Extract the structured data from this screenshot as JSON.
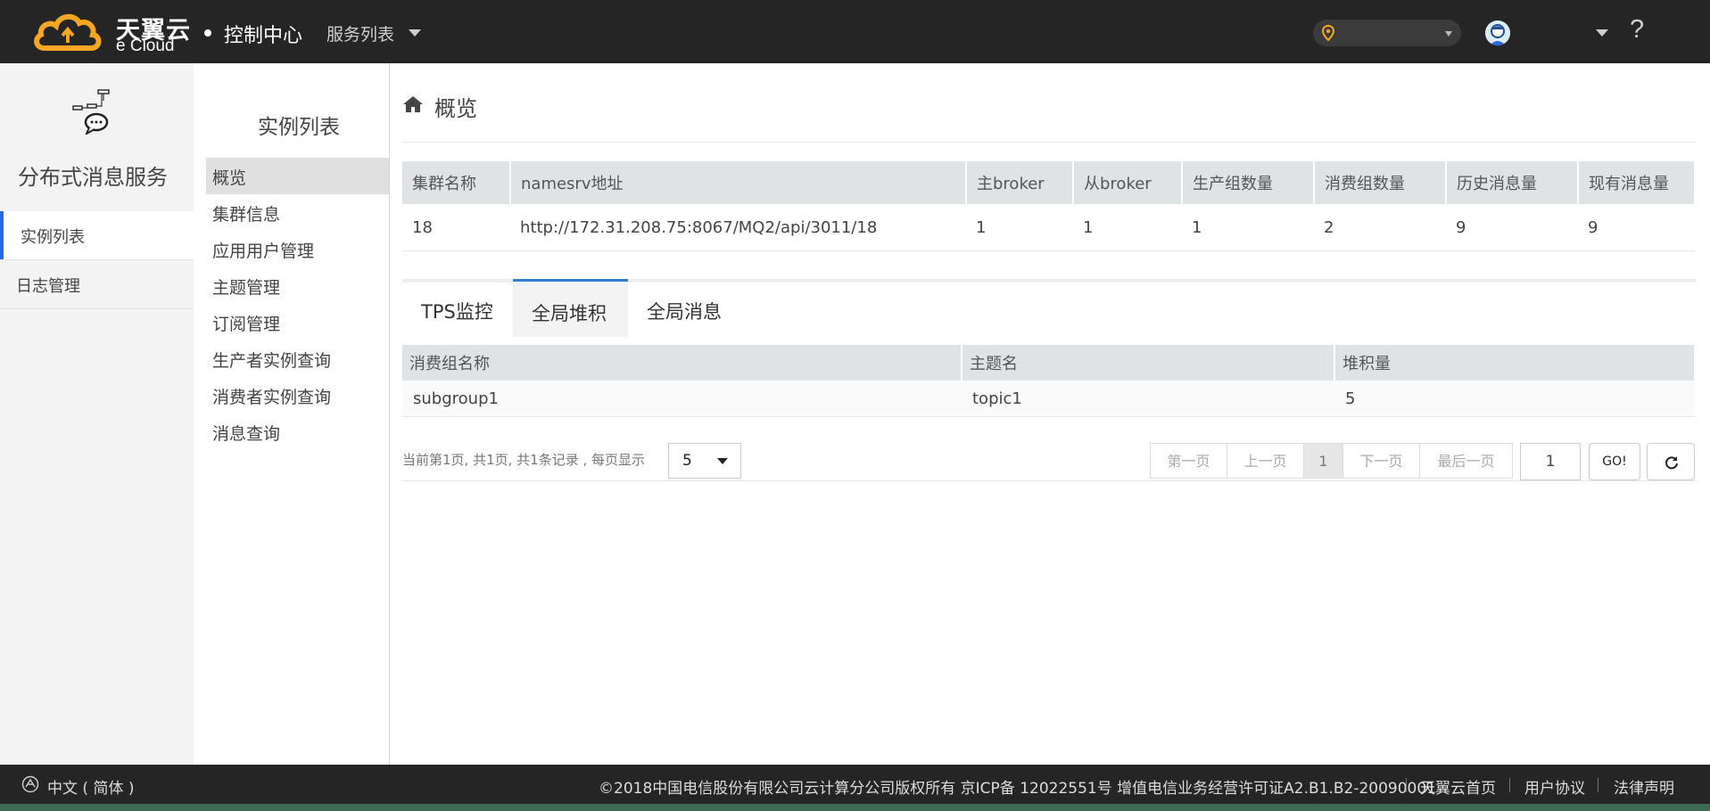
{
  "header": {
    "logo_cn": "天翼云",
    "logo_en": "e Cloud",
    "console_label": "控制中心",
    "service_list_label": "服务列表",
    "help_label": "?"
  },
  "sidebar": {
    "service_title": "分布式消息服务",
    "items": [
      {
        "label": "实例列表",
        "active": true
      },
      {
        "label": "日志管理",
        "active": false
      }
    ]
  },
  "submenu": {
    "title": "实例列表",
    "items": [
      {
        "label": "概览",
        "active": true
      },
      {
        "label": "集群信息"
      },
      {
        "label": "应用用户管理"
      },
      {
        "label": "主题管理"
      },
      {
        "label": "订阅管理"
      },
      {
        "label": "生产者实例查询"
      },
      {
        "label": "消费者实例查询"
      },
      {
        "label": "消息查询"
      }
    ]
  },
  "main": {
    "page_title": "概览",
    "overview_table": {
      "headers": [
        "集群名称",
        "namesrv地址",
        "主broker",
        "从broker",
        "生产组数量",
        "消费组数量",
        "历史消息量",
        "现有消息量"
      ],
      "rows": [
        [
          "18",
          "http://172.31.208.75:8067/MQ2/api/3011/18",
          "1",
          "1",
          "1",
          "2",
          "9",
          "9"
        ]
      ]
    },
    "tabs": [
      {
        "label": "TPS监控",
        "active": false
      },
      {
        "label": "全局堆积",
        "active": true
      },
      {
        "label": "全局消息",
        "active": false
      }
    ],
    "backlog_table": {
      "headers": [
        "消费组名称",
        "主题名",
        "堆积量"
      ],
      "rows": [
        [
          "subgroup1",
          "topic1",
          "5"
        ]
      ]
    },
    "pager": {
      "info": "当前第1页, 共1页, 共1条记录 , 每页显示",
      "page_size": "5",
      "first": "第一页",
      "prev": "上一页",
      "current": "1",
      "next": "下一页",
      "last": "最后一页",
      "goto_value": "1",
      "go_label": "GO!"
    }
  },
  "footer": {
    "language": "中文 ( 简体 )",
    "copyright": "©2018中国电信股份有限公司云计算分公司版权所有 京ICP备 12022551号 增值电信业务经营许可证A2.B1.B2-20090001",
    "links": [
      "天翼云首页",
      "用户协议",
      "法律声明"
    ]
  },
  "colors": {
    "topbar": "#252525",
    "accent_blue": "#2a67e0",
    "tab_active": "#2d7fd6",
    "logo_orange": "#f5a623"
  }
}
